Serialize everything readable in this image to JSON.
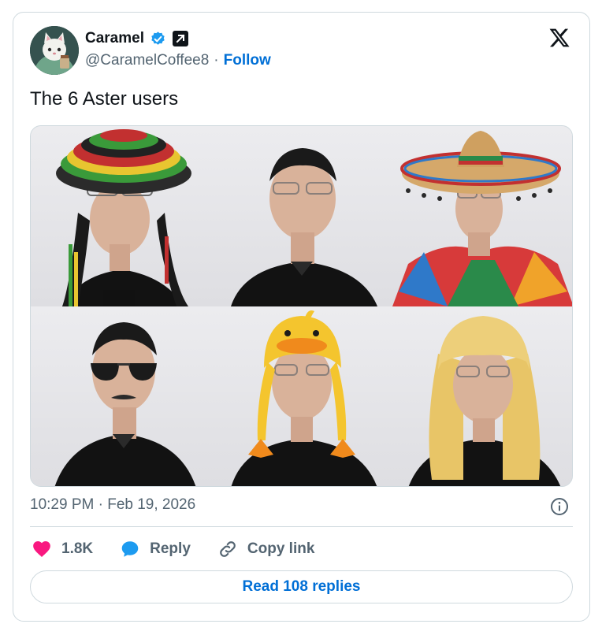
{
  "author": {
    "name": "Caramel",
    "handle": "@CaramelCoffee8",
    "follow_label": "Follow"
  },
  "tweet": {
    "text": "The 6 Aster users",
    "timestamp": "10:29 PM · Feb 19, 2026"
  },
  "media": {
    "photos": [
      {
        "hat": "rasta crochet hat with dreadlocks"
      },
      {
        "hat": "none"
      },
      {
        "hat": "sombrero and serape poncho"
      },
      {
        "hat": "aviator sunglasses and mustache"
      },
      {
        "hat": "yellow duck hat"
      },
      {
        "hat": "blonde wig"
      }
    ]
  },
  "actions": {
    "like_count": "1.8K",
    "reply_label": "Reply",
    "copy_link_label": "Copy link"
  },
  "footer": {
    "read_replies_label": "Read 108 replies"
  },
  "colors": {
    "accent": "#006fd6",
    "like": "#f91880",
    "verified": "#1d9bf0",
    "secondary_text": "#536471",
    "border": "#cfd9de"
  },
  "icons": [
    "verified-badge-icon",
    "external-link-icon",
    "x-logo-icon",
    "info-icon",
    "heart-icon",
    "reply-bubble-icon",
    "link-icon"
  ]
}
